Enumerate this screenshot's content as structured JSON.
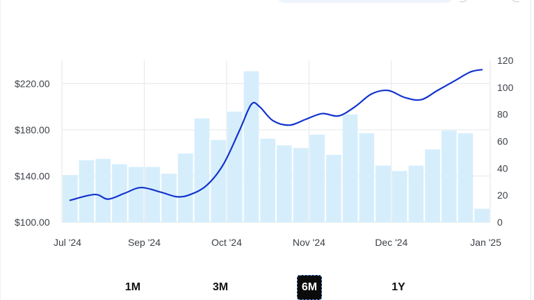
{
  "range_selector": {
    "options": [
      "1M",
      "3M",
      "6M",
      "1Y"
    ],
    "selected": "6M"
  },
  "colors": {
    "line": "#1133cc",
    "bars": "#d6eefc",
    "grid": "#e3e6ea",
    "text": "#3c4047"
  },
  "chart_data": {
    "type": "bar+line",
    "x_ticks": [
      "Jul '24",
      "Sep '24",
      "Oct '24",
      "Nov '24",
      "Dec '24",
      "Jan '25"
    ],
    "left_axis": {
      "ticks": [
        "$100.00",
        "$140.00",
        "$180.00",
        "$220.00"
      ],
      "ylim": [
        100,
        240
      ]
    },
    "right_axis": {
      "ticks": [
        "0",
        "20",
        "40",
        "60",
        "80",
        "100",
        "120"
      ],
      "ylim": [
        0,
        120
      ]
    },
    "bars": {
      "axis": "right",
      "values": [
        35,
        46,
        47,
        43,
        41,
        41,
        36,
        51,
        77,
        61,
        82,
        112,
        62,
        57,
        55,
        65,
        50,
        80,
        66,
        42,
        38,
        42,
        54,
        68,
        66,
        10
      ]
    },
    "line": {
      "axis": "left",
      "x": [
        0.0,
        1.5,
        2.3,
        3.3,
        4.3,
        5.5,
        6.5,
        7.3,
        8.3,
        9.3,
        10.3,
        11.0,
        11.5,
        12.3,
        13.3,
        14.3,
        15.3,
        16.3,
        17.3,
        18.3,
        19.3,
        20.3,
        21.3,
        22.3,
        23.3,
        24.3,
        25.0
      ],
      "values": [
        119,
        124,
        120,
        125,
        130,
        126,
        122,
        124,
        132,
        150,
        180,
        202,
        200,
        188,
        184,
        189,
        194,
        192,
        200,
        211,
        214,
        208,
        206,
        214,
        222,
        230,
        232
      ]
    },
    "grid": "x-and-y, light",
    "legend": "none"
  }
}
